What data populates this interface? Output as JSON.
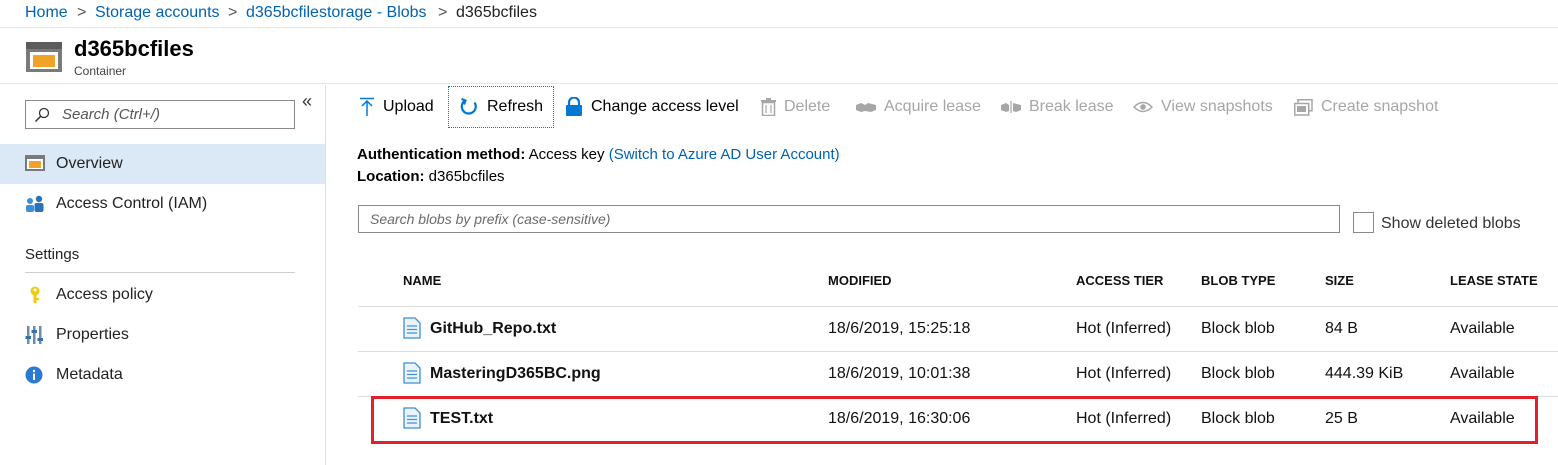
{
  "breadcrumb": {
    "items": [
      "Home",
      "Storage accounts",
      "d365bcfilestorage - Blobs"
    ],
    "current": "d365bcfiles",
    "separator": ">"
  },
  "header": {
    "title": "d365bcfiles",
    "subtitle": "Container",
    "icon": "container-icon"
  },
  "sidebar": {
    "collapse_glyph": "«",
    "search_placeholder": "Search (Ctrl+/)",
    "items": [
      {
        "label": "Overview",
        "icon": "overview-icon",
        "active": true
      },
      {
        "label": "Access Control (IAM)",
        "icon": "iam-icon",
        "active": false
      }
    ],
    "settings_heading": "Settings",
    "settings_items": [
      {
        "label": "Access policy",
        "icon": "key-icon"
      },
      {
        "label": "Properties",
        "icon": "properties-icon"
      },
      {
        "label": "Metadata",
        "icon": "info-icon"
      }
    ]
  },
  "toolbar": {
    "upload": "Upload",
    "refresh": "Refresh",
    "change_access": "Change access level",
    "delete": "Delete",
    "acquire_lease": "Acquire lease",
    "break_lease": "Break lease",
    "view_snapshots": "View snapshots",
    "create_snapshot": "Create snapshot"
  },
  "info": {
    "auth_label": "Authentication method:",
    "auth_value": "Access key",
    "auth_link": "(Switch to Azure AD User Account)",
    "location_label": "Location:",
    "location_value": "d365bcfiles"
  },
  "blob_search": {
    "placeholder": "Search blobs by prefix (case-sensitive)"
  },
  "show_deleted": {
    "label": "Show deleted blobs",
    "checked": false
  },
  "table": {
    "columns": [
      "NAME",
      "MODIFIED",
      "ACCESS TIER",
      "BLOB TYPE",
      "SIZE",
      "LEASE STATE"
    ],
    "rows": [
      {
        "name": "GitHub_Repo.txt",
        "modified": "18/6/2019, 15:25:18",
        "tier": "Hot (Inferred)",
        "type": "Block blob",
        "size": "84 B",
        "lease": "Available"
      },
      {
        "name": "MasteringD365BC.png",
        "modified": "18/6/2019, 10:01:38",
        "tier": "Hot (Inferred)",
        "type": "Block blob",
        "size": "444.39 KiB",
        "lease": "Available"
      },
      {
        "name": "TEST.txt",
        "modified": "18/6/2019, 16:30:06",
        "tier": "Hot (Inferred)",
        "type": "Block blob",
        "size": "25 B",
        "lease": "Available",
        "highlighted": true
      }
    ]
  },
  "colors": {
    "link": "#0063b1",
    "accent": "#0078d4",
    "highlight_border": "#e0202a",
    "active_nav": "#dbe9f7"
  }
}
